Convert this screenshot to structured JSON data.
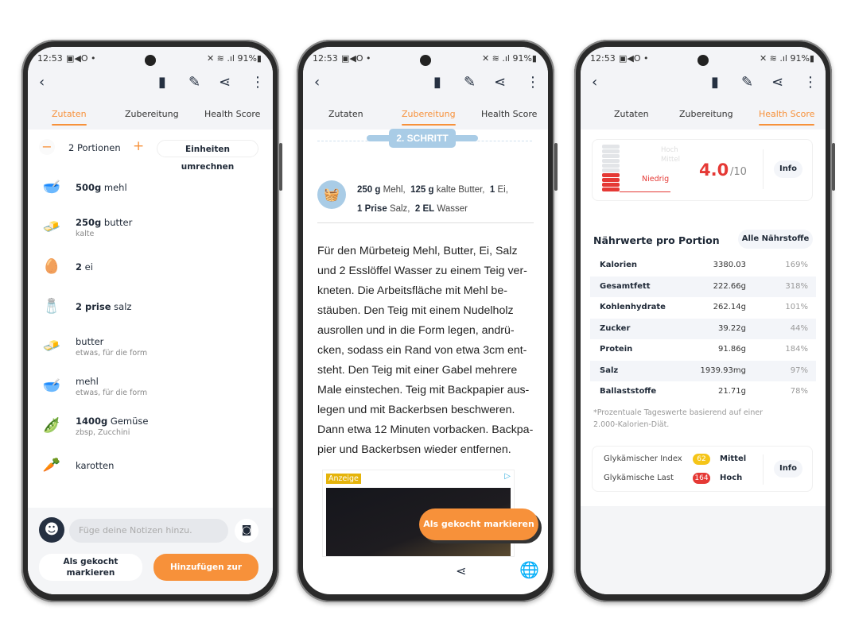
{
  "status": {
    "time": "12:53",
    "icons": "▣◀O •",
    "right": "✕ ≋ .ıl 91%▮"
  },
  "header_icons": [
    "back-arrow-icon",
    "bookmark-icon",
    "pencil-icon",
    "share-icon",
    "more-vert-icon"
  ],
  "tabs": [
    "Zutaten",
    "Zubereitung",
    "Health Score"
  ],
  "accent": "#f7913a",
  "phone1": {
    "active_tab": "Zutaten",
    "portions": "2 Portionen",
    "convert": "Einheiten umrechnen",
    "ingredients": [
      {
        "amount": "500g",
        "name": "mehl",
        "note": "",
        "icon": "🥣"
      },
      {
        "amount": "250g",
        "name": "butter",
        "note": "kalte",
        "icon": "🧈"
      },
      {
        "amount": "2",
        "name": "ei",
        "note": "",
        "icon": "🥚"
      },
      {
        "amount": "2 prise",
        "name": "salz",
        "note": "",
        "icon": "🧂"
      },
      {
        "amount": "",
        "name": "butter",
        "note": "etwas, für die form",
        "icon": "🧈"
      },
      {
        "amount": "",
        "name": "mehl",
        "note": "etwas, für die form",
        "icon": "🥣"
      },
      {
        "amount": "1400g",
        "name": "Gemüse",
        "note": "zbsp, Zucchini",
        "icon": "🫛"
      },
      {
        "amount": "",
        "name": "karotten",
        "note": "",
        "icon": "🥕"
      }
    ],
    "notes_placeholder": "Füge deine Notizen hinzu.",
    "mark_cooked": "Als gekocht markieren",
    "add_to": "Hinzufügen zur"
  },
  "phone2": {
    "active_tab": "Zubereitung",
    "step": "2. SCHRITT",
    "ingredients_line1": [
      {
        "q": "250 g",
        "n": "Mehl,"
      },
      {
        "q": "125 g",
        "n": "kalte Butter,"
      },
      {
        "q": "1",
        "n": "Ei,"
      }
    ],
    "ingredients_line2": [
      {
        "q": "1 Prise",
        "n": "Salz,"
      },
      {
        "q": "2 EL",
        "n": "Wasser"
      }
    ],
    "lines": [
      "Für den Mürbeteig Mehl, Butter, Ei, Salz",
      "und 2 Esslöffel Wasser zu einem Teig ver-",
      "kneten. Die Arbeitsfläche mit Mehl be-",
      "stäuben. Den Teig mit einem Nudelholz",
      "ausrollen und in die Form legen, andrü-",
      "cken, sodass ein Rand von etwa 3cm ent-",
      "steht. Den Teig mit einer Gabel mehrere",
      "Male einstechen. Teig mit Backpapier aus-",
      "legen und mit Backerbsen beschweren.",
      "Dann etwa 12 Minuten vorbacken. Backpa-",
      "pier und Backerbsen wieder entfernen."
    ],
    "ad_label": "Anzeige",
    "mark_cooked": "Als gekocht markieren"
  },
  "phone3": {
    "active_tab": "Health Score",
    "levels": [
      "Hoch",
      "Mittel",
      "Niedrig"
    ],
    "score": "4.0",
    "score_max": "/10",
    "score_value": 4.0,
    "info": "Info",
    "nutrition_title": "Nährwerte pro Portion",
    "all_nutrients": "Alle Nährstoffe",
    "nutrients": [
      {
        "name": "Kalorien",
        "value": "3380.03",
        "pct": "169%"
      },
      {
        "name": "Gesamtfett",
        "value": "222.66g",
        "pct": "318%"
      },
      {
        "name": "Kohlenhydrate",
        "value": "262.14g",
        "pct": "101%"
      },
      {
        "name": "Zucker",
        "value": "39.22g",
        "pct": "44%"
      },
      {
        "name": "Protein",
        "value": "91.86g",
        "pct": "184%"
      },
      {
        "name": "Salz",
        "value": "1939.93mg",
        "pct": "97%"
      },
      {
        "name": "Ballaststoffe",
        "value": "21.71g",
        "pct": "78%"
      }
    ],
    "footnote": "*Prozentuale Tageswerte basierend auf einer 2.000-Kalorien-Diät.",
    "gi_label": "Glykämischer Index",
    "gi_value": "62",
    "gi_level": "Mittel",
    "gi_color": "#f5c518",
    "gl_label": "Glykämische Last",
    "gl_value": "164",
    "gl_level": "Hoch",
    "gl_color": "#e53935"
  }
}
